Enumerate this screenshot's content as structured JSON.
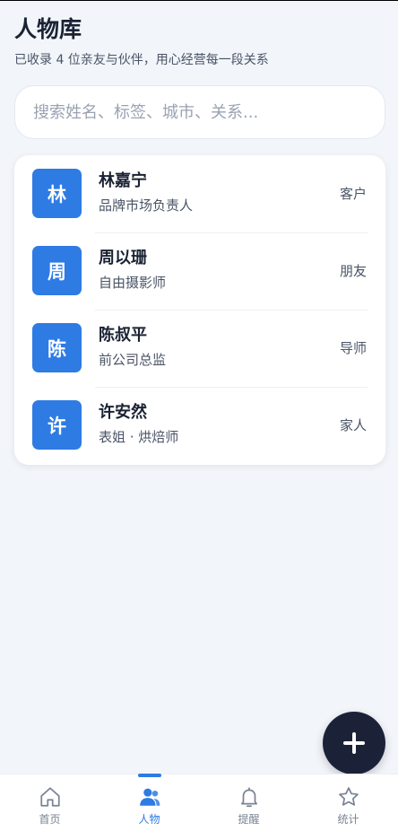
{
  "header": {
    "title": "人物库",
    "subtitle": "已收录 4 位亲友与伙伴，用心经营每一段关系"
  },
  "search": {
    "placeholder": "搜索姓名、标签、城市、关系..."
  },
  "people": [
    {
      "avatar": "林",
      "name": "林嘉宁",
      "desc": "品牌市场负责人",
      "tag": "客户"
    },
    {
      "avatar": "周",
      "name": "周以珊",
      "desc": "自由摄影师",
      "tag": "朋友"
    },
    {
      "avatar": "陈",
      "name": "陈叔平",
      "desc": "前公司总监",
      "tag": "导师"
    },
    {
      "avatar": "许",
      "name": "许安然",
      "desc": "表姐 · 烘焙师",
      "tag": "家人"
    }
  ],
  "fab": {
    "icon": "plus-icon"
  },
  "tabbar": {
    "items": [
      {
        "label": "首页",
        "icon": "home-icon",
        "active": false
      },
      {
        "label": "人物",
        "icon": "people-icon",
        "active": true
      },
      {
        "label": "提醒",
        "icon": "bell-icon",
        "active": false
      },
      {
        "label": "统计",
        "icon": "star-icon",
        "active": false
      }
    ]
  },
  "colors": {
    "accent": "#2e7be4",
    "fab": "#1b2238",
    "background": "#f2f5fa"
  }
}
